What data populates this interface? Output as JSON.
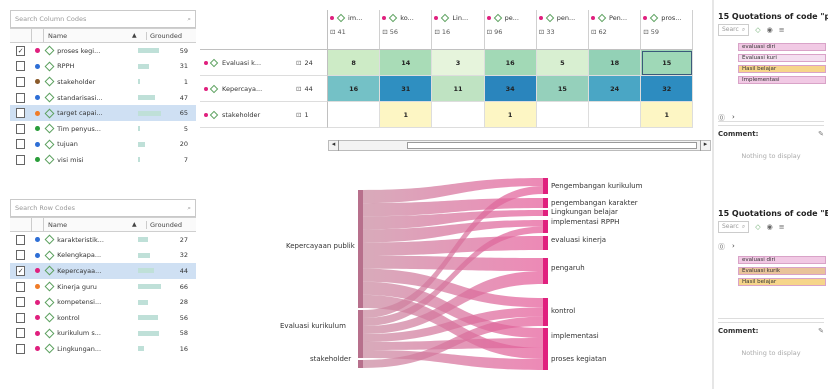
{
  "left": {
    "column_search_placeholder": "Search Column Codes",
    "row_search_placeholder": "Search Row Codes",
    "header_name": "Name",
    "header_grounded": "Grounded",
    "column_codes": [
      {
        "checked": true,
        "color": "#e0207e",
        "name": "proses kegi...",
        "grounded": "59",
        "bar": 0.55,
        "selected": false
      },
      {
        "checked": false,
        "color": "#2f6fd6",
        "name": "RPPH",
        "grounded": "31",
        "bar": 0.3,
        "selected": false
      },
      {
        "checked": false,
        "color": "#8a5a2b",
        "name": "stakeholder",
        "grounded": "1",
        "bar": 0.0,
        "selected": false
      },
      {
        "checked": false,
        "color": "#2f6fd6",
        "name": "standarisasi...",
        "grounded": "47",
        "bar": 0.45,
        "selected": false
      },
      {
        "checked": false,
        "color": "#f07c28",
        "name": "target capai...",
        "grounded": "65",
        "bar": 0.62,
        "selected": true
      },
      {
        "checked": false,
        "color": "#2a9d3a",
        "name": "Tim penyus...",
        "grounded": "5",
        "bar": 0.05,
        "selected": false
      },
      {
        "checked": false,
        "color": "#2f6fd6",
        "name": "tujuan",
        "grounded": "20",
        "bar": 0.2,
        "selected": false
      },
      {
        "checked": false,
        "color": "#2a9d3a",
        "name": "visi misi",
        "grounded": "7",
        "bar": 0.07,
        "selected": false
      }
    ],
    "row_codes": [
      {
        "checked": false,
        "color": "#2f6fd6",
        "name": "karakteristik...",
        "grounded": "27",
        "bar": 0.27,
        "selected": false
      },
      {
        "checked": false,
        "color": "#2f6fd6",
        "name": "Kelengkapa...",
        "grounded": "32",
        "bar": 0.32,
        "selected": false
      },
      {
        "checked": true,
        "color": "#e0207e",
        "name": "Kepercayaa...",
        "grounded": "44",
        "bar": 0.42,
        "selected": true
      },
      {
        "checked": false,
        "color": "#f07c28",
        "name": "Kinerja guru",
        "grounded": "66",
        "bar": 0.62,
        "selected": false
      },
      {
        "checked": false,
        "color": "#e0207e",
        "name": "kompetensi...",
        "grounded": "28",
        "bar": 0.28,
        "selected": false
      },
      {
        "checked": false,
        "color": "#e0207e",
        "name": "kontrol",
        "grounded": "56",
        "bar": 0.53,
        "selected": false
      },
      {
        "checked": false,
        "color": "#e0207e",
        "name": "kurikulum s...",
        "grounded": "58",
        "bar": 0.55,
        "selected": false
      },
      {
        "checked": false,
        "color": "#e0207e",
        "name": "Lingkungan...",
        "grounded": "16",
        "bar": 0.16,
        "selected": false
      }
    ]
  },
  "matrix": {
    "columns": [
      {
        "label": "im...",
        "count": "41"
      },
      {
        "label": "ko...",
        "count": "56"
      },
      {
        "label": "Lin...",
        "count": "16"
      },
      {
        "label": "pe...",
        "count": "96"
      },
      {
        "label": "pen...",
        "count": "33"
      },
      {
        "label": "Pen...",
        "count": "62"
      },
      {
        "label": "pros...",
        "count": "59"
      }
    ],
    "rows": [
      {
        "label": "Evaluasi k...",
        "count": "24",
        "values": [
          "8",
          "14",
          "3",
          "16",
          "5",
          "18",
          "15"
        ]
      },
      {
        "label": "Kepercaya...",
        "count": "44",
        "values": [
          "16",
          "31",
          "11",
          "34",
          "15",
          "24",
          "32"
        ]
      },
      {
        "label": "stakeholder",
        "count": "1",
        "values": [
          "",
          "1",
          "",
          "1",
          "",
          "",
          "1"
        ]
      }
    ],
    "cell_colors": [
      [
        "#cdebc6",
        "#a9dcb7",
        "#e6f4dc",
        "#a2d9b6",
        "#d8efd1",
        "#93d1b6",
        "#9fd8b7"
      ],
      [
        "#74c1c6",
        "#2f8fc1",
        "#bfe3c2",
        "#2a85bd",
        "#95d0bb",
        "#4aa6c5",
        "#2d8cc0"
      ],
      [
        "#ffffff",
        "#fdf6c4",
        "#ffffff",
        "#fdf6c4",
        "#ffffff",
        "#ffffff",
        "#fdf6c4"
      ]
    ]
  },
  "sankey": {
    "sources": [
      "Kepercayaan publik",
      "Evaluasi kurikulum",
      "stakeholder"
    ],
    "targets": [
      "Pengembangan kurikulum",
      "pengembangan karakter",
      "Lingkungan belajar",
      "implementasi RPPH",
      "evaluasi kinerja",
      "pengaruh",
      "kontrol",
      "implementasi",
      "proses kegiatan"
    ]
  },
  "quotations": [
    {
      "title": "15 Quotations of code \"p",
      "search": "Searc",
      "tags": [
        "evaluasi diri",
        "Evaluasi kuri",
        "Hasil belajar",
        "Implementasi"
      ],
      "comment_label": "Comment:",
      "empty_text": "Nothing to display"
    },
    {
      "title": "15 Quotations of code \"E",
      "search": "Searc",
      "tags": [
        "evaluasi diri",
        "Evaluasi kurik",
        "Hasil belajar"
      ],
      "comment_label": "Comment:",
      "empty_text": "Nothing to display"
    }
  ],
  "colors": {
    "accent": "#e0207e",
    "selection": "#cfe0f3",
    "sankey_left": "#c98aa0",
    "sankey_right": "#e65c9a"
  }
}
